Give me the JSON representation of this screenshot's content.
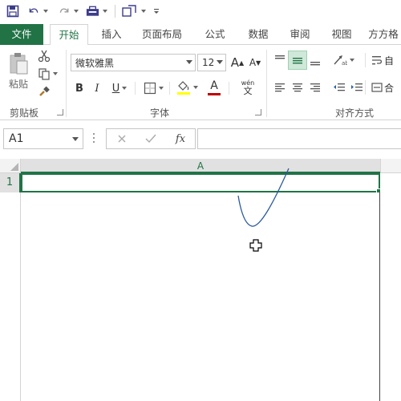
{
  "quick_access": {
    "save_icon": "save-icon",
    "undo_icon": "undo-icon",
    "redo_icon": "redo-icon",
    "toolbar_icon": "toolbar-icon",
    "shape_icon": "shape-icon"
  },
  "tabs": [
    {
      "label": "文件"
    },
    {
      "label": "开始"
    },
    {
      "label": "插入"
    },
    {
      "label": "页面布局"
    },
    {
      "label": "公式"
    },
    {
      "label": "数据"
    },
    {
      "label": "审阅"
    },
    {
      "label": "视图"
    },
    {
      "label": "方方格"
    }
  ],
  "ribbon": {
    "clipboard": {
      "paste_label": "粘贴",
      "group_label": "剪贴板"
    },
    "font": {
      "font_name": "微软雅黑",
      "font_size": "12",
      "bold": "B",
      "italic": "I",
      "underline": "U",
      "increase_font": "A",
      "decrease_font": "A",
      "font_color": "A",
      "phonetic_top": "wén",
      "phonetic_bottom": "文",
      "group_label": "字体",
      "fill_color": "#ffff00",
      "text_color": "#c00000"
    },
    "alignment": {
      "group_label": "对齐方式",
      "wrap_label_fragment": "自",
      "merge_label_fragment": "合"
    }
  },
  "formula_bar": {
    "name_box": "A1",
    "fx_label": "fx"
  },
  "sheet": {
    "column_header": "A",
    "row_header": "1",
    "accent": "#217346"
  }
}
